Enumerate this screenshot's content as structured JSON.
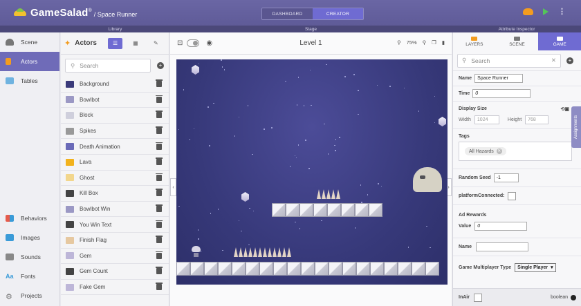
{
  "app": {
    "brand": "GameSalad",
    "trademark": "®",
    "project_title": "/ Space Runner",
    "modes": [
      "DASHBOARD",
      "CREATOR"
    ],
    "active_mode": "CREATOR"
  },
  "sections": {
    "library": "Library",
    "stage": "Stage",
    "inspector": "Attribute Inspector"
  },
  "nav": {
    "top": [
      {
        "label": "Scene",
        "icon": "scene-icon",
        "color": "#666"
      },
      {
        "label": "Actors",
        "icon": "actor-icon",
        "color": "#f39c1f"
      },
      {
        "label": "Tables",
        "icon": "table-icon",
        "color": "#4aa3d9"
      }
    ],
    "bottom": [
      {
        "label": "Behaviors",
        "icon": "behaviors-icon",
        "color": "#e65b4b"
      },
      {
        "label": "Images",
        "icon": "images-icon",
        "color": "#3a9bd8"
      },
      {
        "label": "Sounds",
        "icon": "sounds-icon",
        "color": "#888"
      },
      {
        "label": "Fonts",
        "icon": "fonts-icon",
        "color": "#3a9bd8"
      },
      {
        "label": "Projects",
        "icon": "projects-icon",
        "color": "#888"
      }
    ],
    "active": "Actors"
  },
  "library": {
    "title": "Actors",
    "search_placeholder": "Search",
    "actors": [
      {
        "label": "Background",
        "color": "#3a3a7a"
      },
      {
        "label": "Bowlbot",
        "color": "#9b98c4"
      },
      {
        "label": "Block",
        "color": "#cfcfdc"
      },
      {
        "label": "Spikes",
        "color": "#999"
      },
      {
        "label": "Death Animation",
        "color": "#6a6ab8"
      },
      {
        "label": "Lava",
        "color": "#f2b21c"
      },
      {
        "label": "Ghost",
        "color": "#f2d68c"
      },
      {
        "label": "Kill Box",
        "color": "#444"
      },
      {
        "label": "Bowlbot Win",
        "color": "#9b98c4"
      },
      {
        "label": "You Win Text",
        "color": "#444"
      },
      {
        "label": "Finish Flag",
        "color": "#e6c8a0"
      },
      {
        "label": "Gem",
        "color": "#bdb6d8"
      },
      {
        "label": "Gem Count",
        "color": "#444"
      },
      {
        "label": "Fake Gem",
        "color": "#bdb6d8"
      }
    ]
  },
  "stage": {
    "level_name": "Level 1",
    "zoom": "75%"
  },
  "inspector": {
    "tabs": [
      "LAYERS",
      "SCENE",
      "GAME"
    ],
    "active_tab": "GAME",
    "search_placeholder": "Search",
    "name_label": "Name",
    "name_value": "Space Runner",
    "time_label": "Time",
    "time_value": "0",
    "display_size_label": "Display Size",
    "width_label": "Width",
    "width_value": "1024",
    "height_label": "Height",
    "height_value": "768",
    "tags_label": "Tags",
    "tag": "All Hazards",
    "random_seed_label": "Random Seed",
    "random_seed_value": "-1",
    "platform_label": "platformConnected:",
    "ad_rewards_label": "Ad Rewards",
    "value_label": "Value",
    "value_value": "0",
    "reward_name_label": "Name",
    "reward_name_value": "",
    "multiplayer_label": "Game Multiplayer Type",
    "multiplayer_value": "Single Player",
    "assignments_label": "Assignments",
    "footer_label": "InAir",
    "footer_type": "boolean"
  }
}
